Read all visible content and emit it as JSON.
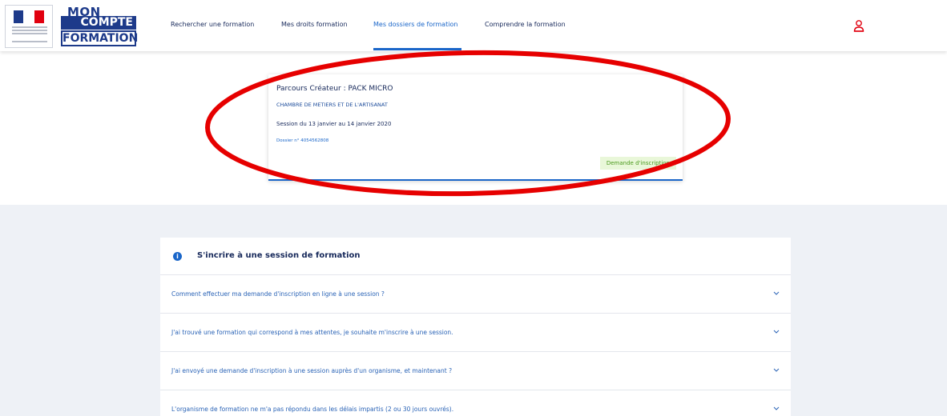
{
  "header": {
    "logo_lines": [
      "MON",
      "COMPTE",
      "FORMATION"
    ],
    "nav": [
      {
        "label": "Rechercher une formation",
        "active": false
      },
      {
        "label": "Mes droits formation",
        "active": false
      },
      {
        "label": "Mes dossiers de formation",
        "active": true
      },
      {
        "label": "Comprendre la formation",
        "active": false
      }
    ],
    "user_icon": "user-icon"
  },
  "card": {
    "title": "Parcours Créateur : PACK MICRO",
    "organism": "CHAMBRE DE METIERS ET DE L'ARTISANAT",
    "session": "Session du 13 janvier au 14 janvier 2020",
    "dossier": "Dossier n° 4054562808",
    "status": "Demande d'inscription"
  },
  "faq": {
    "icon": "info-icon",
    "title": "S'incrire à une session de formation",
    "items": [
      {
        "question": "Comment effectuer ma demande d'inscription en ligne à une session ?"
      },
      {
        "question": "J'ai trouvé une formation qui correspond à mes attentes, je souhaite m'inscrire à une session."
      },
      {
        "question": "J'ai envoyé une demande d'inscription à une session auprès d'un organisme, et maintenant ?"
      },
      {
        "question": "L'organisme de formation ne m'a pas répondu dans les délais impartis (2 ou 30 jours ouvrés)."
      }
    ]
  },
  "colors": {
    "primary": "#1a66c9",
    "navy": "#16285a",
    "status_bg": "#e9f7d9",
    "status_text": "#4c9a1e",
    "annotation": "#e60000"
  }
}
